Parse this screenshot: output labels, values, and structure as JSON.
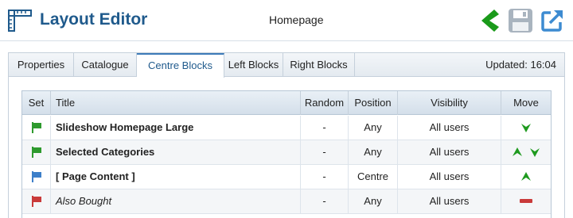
{
  "header": {
    "app_title": "Layout Editor",
    "page_name": "Homepage",
    "icons": [
      "layout-ruler-icon",
      "back-arrow-icon",
      "save-disk-icon",
      "external-link-icon"
    ],
    "colors": {
      "brand": "#1f5a8c",
      "back": "#1a9a1a",
      "save": "#a9b4bf",
      "export": "#3d8bd1"
    }
  },
  "tabs": {
    "items": [
      {
        "label": "Properties",
        "active": false
      },
      {
        "label": "Catalogue",
        "active": false
      },
      {
        "label": "Centre Blocks",
        "active": true
      },
      {
        "label": "Left Blocks",
        "active": false
      },
      {
        "label": "Right Blocks",
        "active": false
      }
    ],
    "updated": "Updated: 16:04"
  },
  "table": {
    "headers": {
      "set": "Set",
      "title": "Title",
      "random": "Random",
      "position": "Position",
      "visibility": "Visibility",
      "move": "Move"
    },
    "rows": [
      {
        "flag": "green",
        "title": "Slideshow Homepage Large",
        "italic": false,
        "random": "-",
        "position": "Any",
        "visibility": "All users",
        "move": [
          "down"
        ]
      },
      {
        "flag": "green",
        "title": "Selected Categories",
        "italic": false,
        "random": "-",
        "position": "Any",
        "visibility": "All users",
        "move": [
          "up",
          "down"
        ]
      },
      {
        "flag": "blue",
        "title": "[ Page Content ]",
        "italic": false,
        "random": "-",
        "position": "Centre",
        "visibility": "All users",
        "move": [
          "up"
        ]
      },
      {
        "flag": "red",
        "title": "Also Bought",
        "italic": true,
        "random": "-",
        "position": "Any",
        "visibility": "All users",
        "move": [
          "minus"
        ]
      }
    ],
    "flag_colors": {
      "green": "#2e9a2e",
      "blue": "#3d7fc9",
      "red": "#c93a3a"
    },
    "move_colors": {
      "arrow": "#1f9a1f",
      "minus": "#c93a3a"
    }
  }
}
